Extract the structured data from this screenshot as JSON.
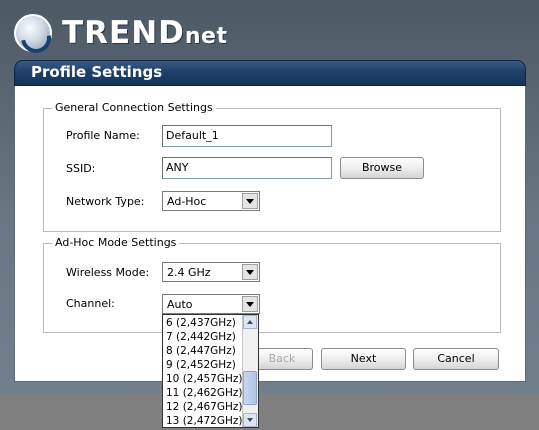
{
  "brand": {
    "logo_text": "TRENDnet",
    "logo_main": "TREND",
    "logo_sub": "net"
  },
  "panel": {
    "title": "Profile Settings"
  },
  "general": {
    "legend": "General Connection Settings",
    "profile_name_label": "Profile Name:",
    "profile_name_value": "Default_1",
    "ssid_label": "SSID:",
    "ssid_value": "ANY",
    "browse_label": "Browse",
    "network_type_label": "Network Type:",
    "network_type_value": "Ad-Hoc"
  },
  "adhoc": {
    "legend": "Ad-Hoc Mode Settings",
    "wireless_mode_label": "Wireless Mode:",
    "wireless_mode_value": "2.4 GHz",
    "channel_label": "Channel:",
    "channel_value": "Auto",
    "channel_options": [
      "6 (2,437GHz)",
      "7 (2,442GHz)",
      "8 (2,447GHz)",
      "9 (2,452GHz)",
      "10 (2,457GHz)",
      "11 (2,462GHz)",
      "12 (2,467GHz)",
      "13 (2,472GHz)"
    ]
  },
  "buttons": {
    "back": "Back",
    "next": "Next",
    "cancel": "Cancel"
  }
}
